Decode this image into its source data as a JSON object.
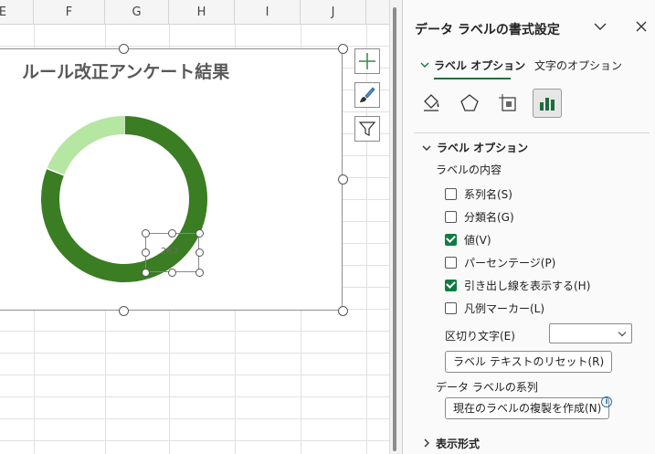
{
  "sheet": {
    "columns": [
      "E",
      "F",
      "G",
      "H",
      "I",
      "J"
    ]
  },
  "chart": {
    "title": "ルール改正アンケート結果",
    "data_label": "262"
  },
  "chart_data": {
    "type": "pie",
    "title": "ルール改正アンケート結果",
    "slices": [
      {
        "fraction": 0.81,
        "color": "#3a7d23"
      },
      {
        "fraction": 0.19,
        "color": "#b5e6a2"
      }
    ],
    "data_labels": [
      "262"
    ]
  },
  "side_buttons": [
    {
      "icon": "plus-icon"
    },
    {
      "icon": "brush-icon"
    },
    {
      "icon": "filter-icon"
    }
  ],
  "pane": {
    "title": "データ ラベルの書式設定",
    "tabs": [
      {
        "label": "ラベル オプション",
        "active": true
      },
      {
        "label": "文字のオプション",
        "active": false
      }
    ],
    "icons": [
      "fill-line-icon",
      "effects-icon",
      "size-properties-icon",
      "label-options-icon"
    ],
    "section_header": "ラベル オプション",
    "section_sub": "ラベルの内容",
    "checkboxes": [
      {
        "label": "系列名(S)",
        "checked": false
      },
      {
        "label": "分類名(G)",
        "checked": false
      },
      {
        "label": "値(V)",
        "checked": true
      },
      {
        "label": "パーセンテージ(P)",
        "checked": false
      },
      {
        "label": "引き出し線を表示する(H)",
        "checked": true
      },
      {
        "label": "凡例マーカー(L)",
        "checked": false
      }
    ],
    "separator_label": "区切り文字(E)",
    "separator_value": "",
    "reset_button": "ラベル テキストのリセット(R)",
    "series_label": "データ ラベルの系列",
    "copy_button": "現在のラベルの複製を作成(N)",
    "section2": "表示形式",
    "accent": "#107c41"
  }
}
